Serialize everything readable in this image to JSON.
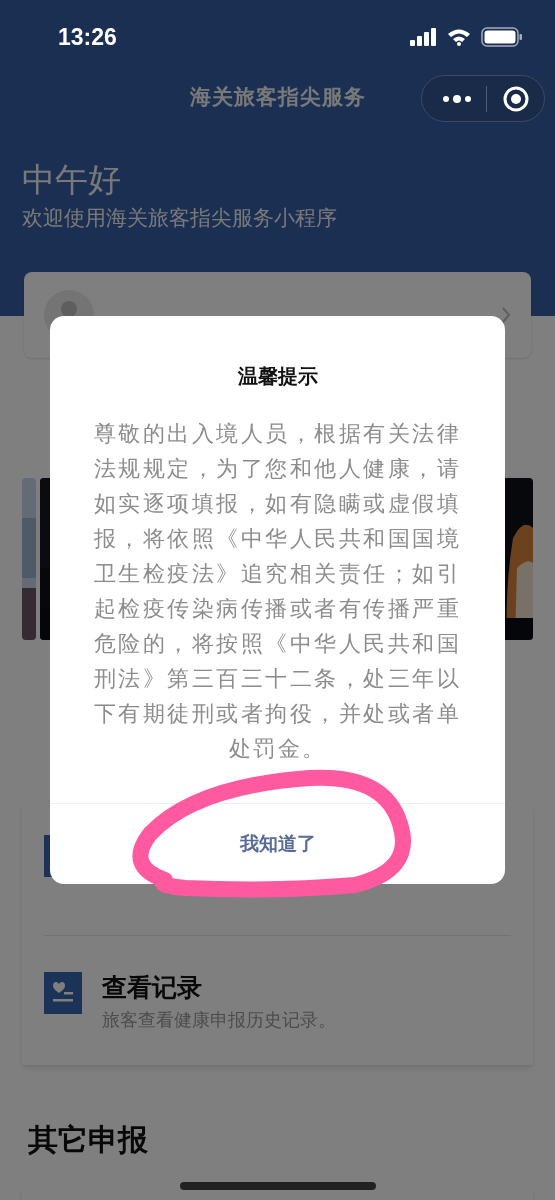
{
  "status_bar": {
    "time": "13:26"
  },
  "nav": {
    "title": "海关旅客指尖服务"
  },
  "header": {
    "greeting": "中午好",
    "subtitle": "欢迎使用海关旅客指尖服务小程序"
  },
  "sections": [
    {
      "kind": "carousel"
    },
    {
      "kind": "list",
      "items": [
        {
          "kind": "icon_only"
        },
        {
          "kind": "text",
          "title": "查看记录",
          "subtitle": "旅客查看健康申报历史记录。"
        }
      ]
    },
    {
      "kind": "card",
      "title": "其它申报"
    }
  ],
  "dialog": {
    "title": "温馨提示",
    "message": "尊敬的出入境人员，根据有关法律法规规定，为了您和他人健康，请如实逐项填报，如有隐瞒或虚假填报，将依照《中华人民共和国国境卫生检疫法》追究相关责任；如引起检疫传染病传播或者有传播严重危险的，将按照《中华人民共和国刑法》第三百三十二条，处三年以下有期徒刑或者拘役，并处或者单处罚金。",
    "button": "我知道了"
  }
}
